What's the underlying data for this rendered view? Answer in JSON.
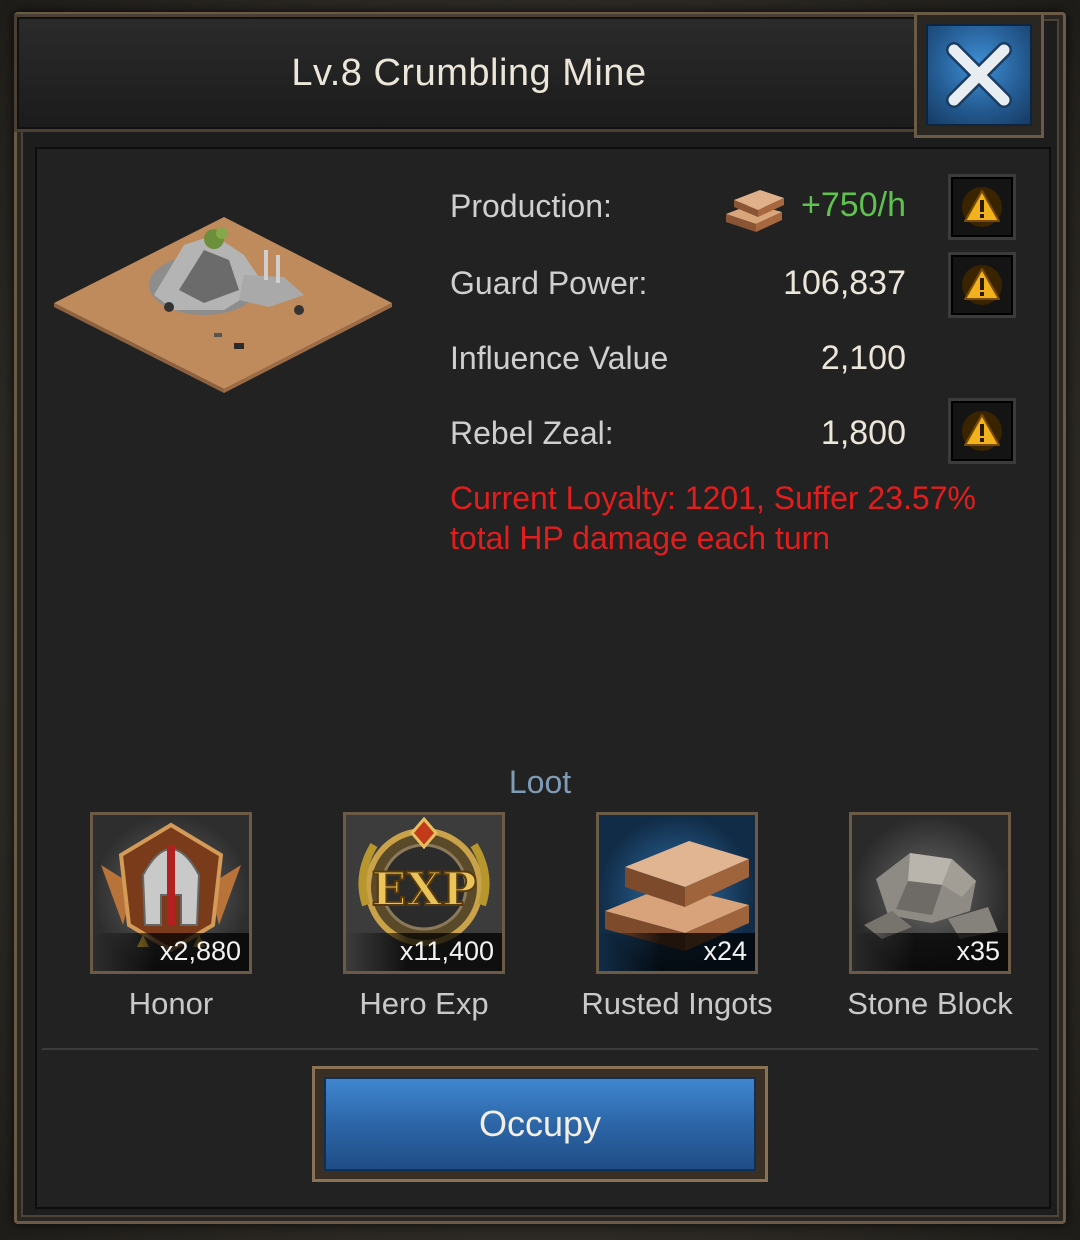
{
  "window": {
    "title": "Lv.8 Crumbling Mine",
    "close_icon": "close-x-icon"
  },
  "stats": {
    "production": {
      "label": "Production:",
      "value": "+750/h",
      "icon": "rusted-ingot-icon",
      "value_color": "#5fc24f"
    },
    "guard_power": {
      "label": "Guard Power:",
      "value": "106,837"
    },
    "influence": {
      "label": "Influence Value",
      "value": "2,100"
    },
    "rebel_zeal": {
      "label": "Rebel Zeal:",
      "value": "1,800"
    }
  },
  "warning": {
    "line1": "Current Loyalty: 1201, Suffer 23.57%",
    "line2": "total HP damage each turn",
    "color": "#e01e1e"
  },
  "loot": {
    "title": "Loot",
    "items": [
      {
        "name": "Honor",
        "count": "x2,880",
        "icon": "spartan-helmet-icon"
      },
      {
        "name": "Hero Exp",
        "count": "x11,400",
        "icon": "exp-badge-icon"
      },
      {
        "name": "Rusted Ingots",
        "count": "x24",
        "icon": "ingot-stack-icon"
      },
      {
        "name": "Stone Block",
        "count": "x35",
        "icon": "stone-block-icon"
      }
    ]
  },
  "actions": {
    "occupy_label": "Occupy"
  }
}
